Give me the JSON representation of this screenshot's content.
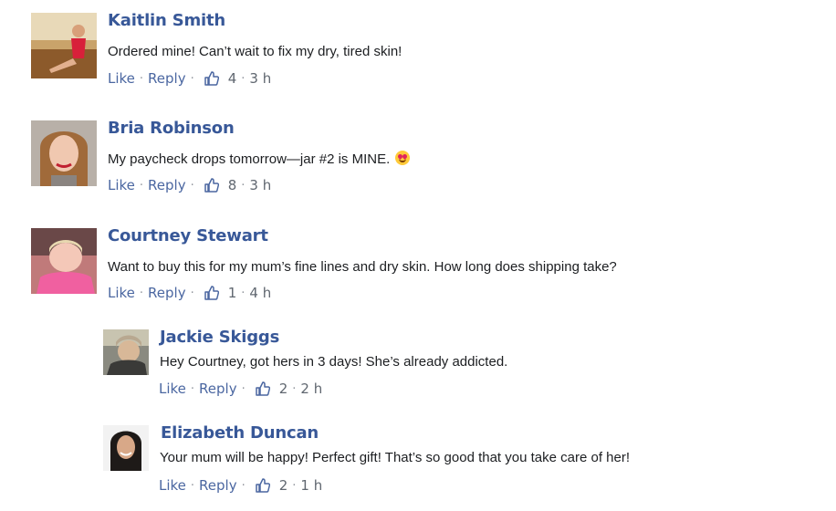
{
  "colors": {
    "name": "#385898",
    "link": "#4b67a1",
    "meta": "#606770",
    "text": "#1c1e21"
  },
  "actions": {
    "like_label": "Like",
    "reply_label": "Reply",
    "sep": "·",
    "like_icon": "thumbs-up-icon"
  },
  "comments": [
    {
      "name": "Kaitlin Smith",
      "text": "Ordered mine! Can’t wait to fix my dry, tired skin!",
      "likes": "4",
      "time": "3 h"
    },
    {
      "name": "Bria Robinson",
      "text": "My paycheck drops tomorrow—jar #2 is MINE.",
      "emoji": "heart-eyes-emoji",
      "likes": "8",
      "time": "3 h"
    },
    {
      "name": "Courtney Stewart",
      "text": "Want to buy this for my mum’s fine lines and dry skin. How long does shipping take?",
      "likes": "1",
      "time": "4 h"
    },
    {
      "name": "Jackie Skiggs",
      "text": "Hey Courtney, got hers in 3 days! She’s already addicted.",
      "likes": "2",
      "time": "2 h"
    },
    {
      "name": "Elizabeth Duncan",
      "text": "Your mum will be happy! Perfect gift! That’s so good that you take care of her!",
      "likes": "2",
      "time": "1 h"
    }
  ]
}
